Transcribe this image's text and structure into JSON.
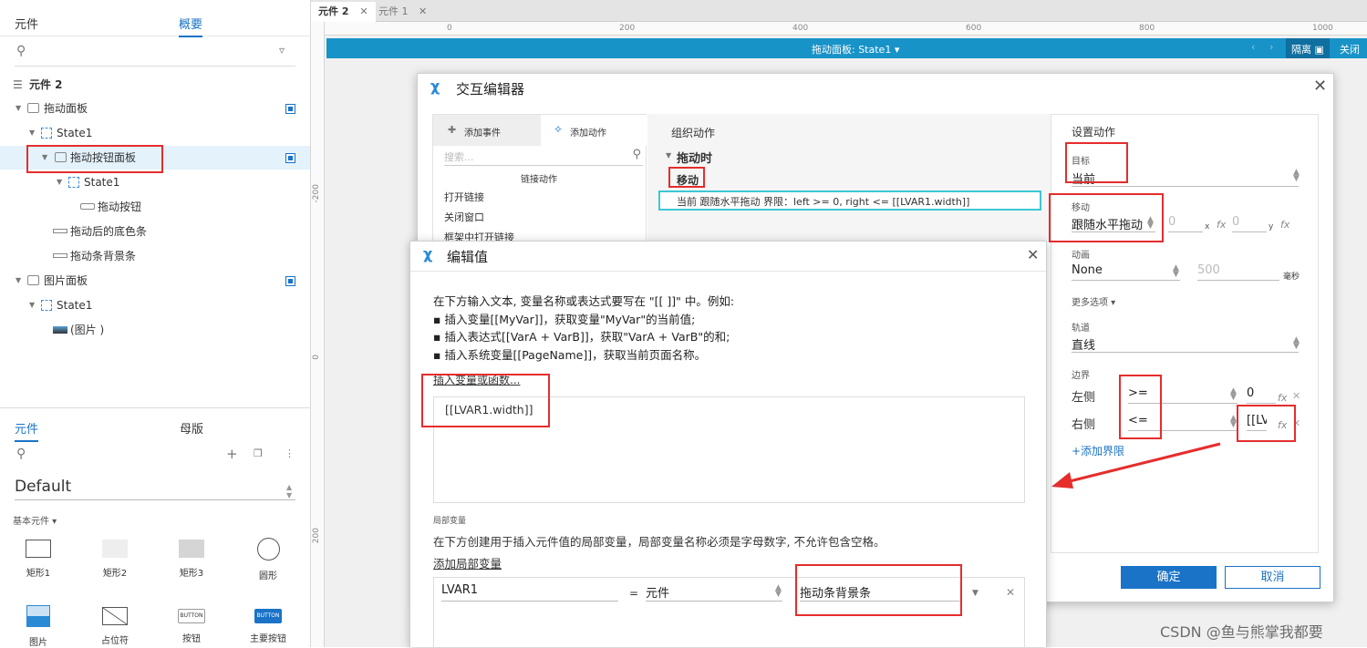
{
  "left_panel": {
    "tabs": [
      "元件",
      "概要"
    ],
    "page_name": "元件 2",
    "tree": [
      {
        "label": "拖动面板"
      },
      {
        "label": "State1"
      },
      {
        "label": "拖动按钮面板"
      },
      {
        "label": "State1"
      },
      {
        "label": "拖动按钮"
      },
      {
        "label": "拖动后的底色条"
      },
      {
        "label": "拖动条背景条"
      },
      {
        "label": "图片面板"
      },
      {
        "label": "State1"
      },
      {
        "label": "(图片 )"
      }
    ],
    "lib_tabs": [
      "元件",
      "母版"
    ],
    "library_select": "Default",
    "category": "基本元件 ▾",
    "widgets": [
      "矩形1",
      "矩形2",
      "矩形3",
      "圆形",
      "图片",
      "占位符",
      "按钮",
      "主要按钮"
    ],
    "button_glyph": "BUTTON"
  },
  "doc_tabs": [
    "元件 2",
    "元件 1"
  ],
  "ruler_h": [
    "0",
    "200",
    "400",
    "600",
    "800",
    "1000"
  ],
  "ruler_v": [
    "-200",
    "0",
    "200"
  ],
  "state_bar": {
    "label": "拖动面板: State1 ▾",
    "isolate": "隔离",
    "close": "关闭"
  },
  "interaction_editor": {
    "title": "交互编辑器",
    "tabs": [
      "添加事件",
      "添加动作"
    ],
    "search_placeholder": "搜索...",
    "section": "链接动作",
    "actions": [
      "打开链接",
      "关闭窗口",
      "框架中打开链接"
    ],
    "organize_title": "组织动作",
    "event": "拖动时",
    "action": "移动",
    "action_detail": "当前 跟随水平拖动 界限：left >= 0, right <= [[LVAR1.width]]",
    "settings_title": "设置动作",
    "target_label": "目标",
    "target_value": "当前",
    "move_label": "移动",
    "move_value": "跟随水平拖动",
    "x_value": "0",
    "x_unit": "x",
    "y_value": "0",
    "y_unit": "y",
    "anim_label": "动画",
    "anim_value": "None",
    "anim_ms": "500",
    "ms_unit": "毫秒",
    "more_options": "更多选项 ▾",
    "track_label": "轨道",
    "track_value": "直线",
    "bounds_label": "边界",
    "left_label": "左侧",
    "left_op": ">=",
    "left_value": "0",
    "right_label": "右侧",
    "right_op": "<=",
    "right_value": "[[LV",
    "add_bound": "+添加界限",
    "ok": "确定",
    "cancel": "取消"
  },
  "edit_value": {
    "title": "编辑值",
    "instructions": [
      "在下方输入文本, 变量名称或表达式要写在 \"[[ ]]\" 中。例如:",
      "▪ 插入变量[[MyVar]]，获取变量\"MyVar\"的当前值;",
      "▪ 插入表达式[[VarA + VarB]]，获取\"VarA + VarB\"的和;",
      "▪ 插入系统变量[[PageName]]，获取当前页面名称。"
    ],
    "insert_link": "插入变量或函数...",
    "expression": "[[LVAR1.width]]",
    "local_title": "局部变量",
    "local_desc": "在下方创建用于插入元件值的局部变量，局部变量名称必须是字母数字, 不允许包含空格。",
    "add_local": "添加局部变量",
    "var_name": "LVAR1",
    "equals": "=",
    "var_type": "元件",
    "var_target": "拖动条背景条"
  },
  "watermark": "CSDN @鱼与熊掌我都要",
  "colors": {
    "accent": "#1a73c7",
    "highlight": "#e52d2d",
    "teal": "#1793c8"
  }
}
